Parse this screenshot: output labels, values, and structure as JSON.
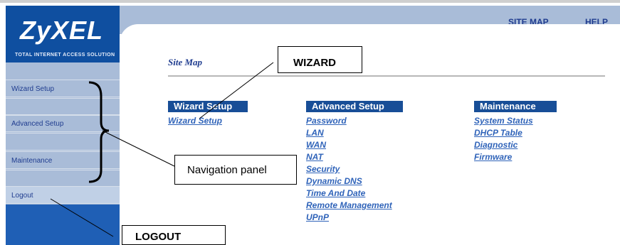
{
  "brand": {
    "name": "ZyXEL",
    "tagline": "TOTAL INTERNET ACCESS SOLUTION",
    "brand_blue": "#0f4fa0",
    "accent_light": "#a9bcd8"
  },
  "top_nav": {
    "site_map": "SITE MAP",
    "help": "HELP"
  },
  "sidebar": {
    "items": [
      {
        "label": "Wizard Setup"
      },
      {
        "label": "Advanced Setup"
      },
      {
        "label": "Maintenance"
      },
      {
        "label": "Logout"
      }
    ]
  },
  "page": {
    "title": "Site Map"
  },
  "site_map": {
    "columns": [
      {
        "heading": "Wizard Setup",
        "links": [
          "Wizard Setup"
        ]
      },
      {
        "heading": "Advanced Setup",
        "links": [
          "Password",
          "LAN",
          "WAN",
          "NAT",
          "Security",
          "Dynamic DNS",
          "Time And Date",
          "Remote Management",
          "UPnP"
        ]
      },
      {
        "heading": "Maintenance",
        "links": [
          "System Status",
          "DHCP Table",
          "Diagnostic",
          "Firmware"
        ]
      }
    ]
  },
  "callouts": {
    "wizard": "WIZARD",
    "navigation": "Navigation panel",
    "logout": "LOGOUT"
  }
}
